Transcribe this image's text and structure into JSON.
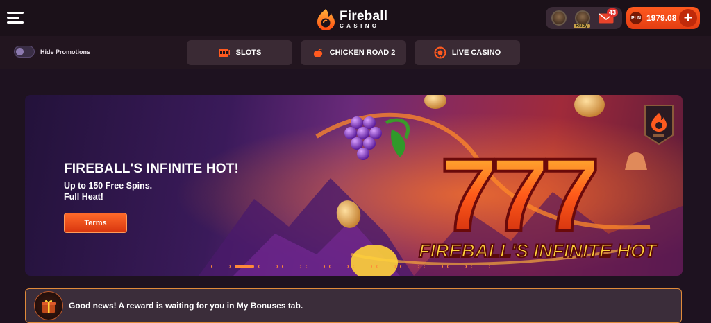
{
  "header": {
    "logo_name": "Fireball",
    "logo_sub": "CASINO",
    "status": {
      "level_label": "Ruby",
      "mail_count": "43"
    },
    "balance": {
      "currency": "PLN",
      "amount": "1979.08",
      "plus": "+"
    }
  },
  "navbar": {
    "toggle_label": "Hide Promotions",
    "items": [
      {
        "label": "SLOTS",
        "icon": "slot-machine-icon"
      },
      {
        "label": "CHICKEN ROAD 2",
        "icon": "chicken-icon"
      },
      {
        "label": "LIVE CASINO",
        "icon": "roulette-icon"
      }
    ]
  },
  "banner": {
    "title": "FIREBALL'S INFINITE HOT!",
    "line1": "Up to 150 Free Spins.",
    "line2": "Full Heat!",
    "button": "Terms",
    "art_title": "FIREBALL'S INFINITE HOT",
    "sevens": "777",
    "slide_count": 12,
    "active_slide": 2
  },
  "notice": {
    "text": "Good news! A reward is waiting for you in My Bonuses tab."
  },
  "colors": {
    "accent": "#ff5a1f",
    "background": "#1e1220",
    "notice_border": "#e08a3a"
  }
}
